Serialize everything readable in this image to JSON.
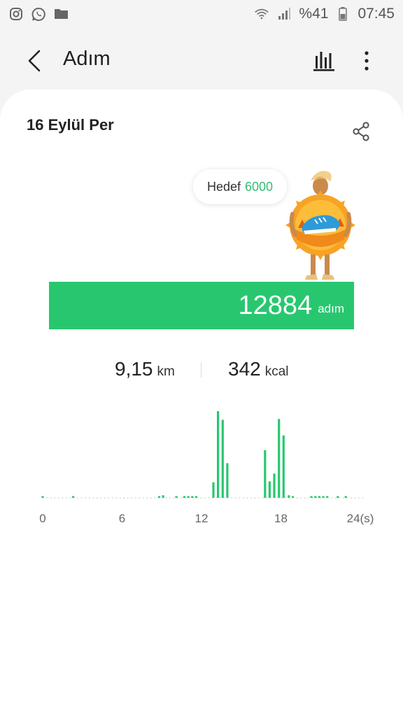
{
  "status_bar": {
    "battery_text": "%41",
    "time": "07:45",
    "left_icons": [
      "instagram-icon",
      "whatsapp-icon",
      "folder-icon"
    ],
    "right_icons": [
      "wifi-icon",
      "signal-icon",
      "battery-icon"
    ]
  },
  "app_bar": {
    "title": "Adım",
    "actions": [
      "bar-chart-icon",
      "more-vert-icon"
    ]
  },
  "card": {
    "date": "16 Eylül Per",
    "goal_label": "Hedef",
    "goal_value": "6000",
    "steps_value": "12884",
    "steps_unit": "adım",
    "progress_fraction": 1.0,
    "distance_value": "9,15",
    "distance_unit": "km",
    "calories_value": "342",
    "calories_unit": "kcal"
  },
  "colors": {
    "accent": "#28c76f",
    "goal_text": "#2fbf71",
    "background": "#f4f4f4",
    "card": "#ffffff"
  },
  "chart_data": {
    "type": "bar",
    "x_unit": "hour",
    "xlim": [
      0,
      24
    ],
    "xticks": [
      "0",
      "6",
      "12",
      "18",
      "24(s)"
    ],
    "xtick_values": [
      0,
      6,
      12,
      18,
      24
    ],
    "bars": [
      {
        "x": 0.0,
        "value": 2
      },
      {
        "x": 2.3,
        "value": 2
      },
      {
        "x": 8.8,
        "value": 2
      },
      {
        "x": 9.1,
        "value": 3
      },
      {
        "x": 10.1,
        "value": 2
      },
      {
        "x": 10.7,
        "value": 2
      },
      {
        "x": 11.0,
        "value": 2
      },
      {
        "x": 11.3,
        "value": 2
      },
      {
        "x": 11.6,
        "value": 2
      },
      {
        "x": 12.9,
        "value": 18
      },
      {
        "x": 13.25,
        "value": 100
      },
      {
        "x": 13.6,
        "value": 90
      },
      {
        "x": 13.95,
        "value": 40
      },
      {
        "x": 16.8,
        "value": 55
      },
      {
        "x": 17.15,
        "value": 19
      },
      {
        "x": 17.5,
        "value": 28
      },
      {
        "x": 17.85,
        "value": 91
      },
      {
        "x": 18.2,
        "value": 72
      },
      {
        "x": 18.6,
        "value": 3
      },
      {
        "x": 18.9,
        "value": 2
      },
      {
        "x": 20.3,
        "value": 2
      },
      {
        "x": 20.6,
        "value": 2
      },
      {
        "x": 20.9,
        "value": 2
      },
      {
        "x": 21.2,
        "value": 2
      },
      {
        "x": 21.5,
        "value": 2
      },
      {
        "x": 22.3,
        "value": 2
      },
      {
        "x": 22.9,
        "value": 2
      }
    ]
  }
}
